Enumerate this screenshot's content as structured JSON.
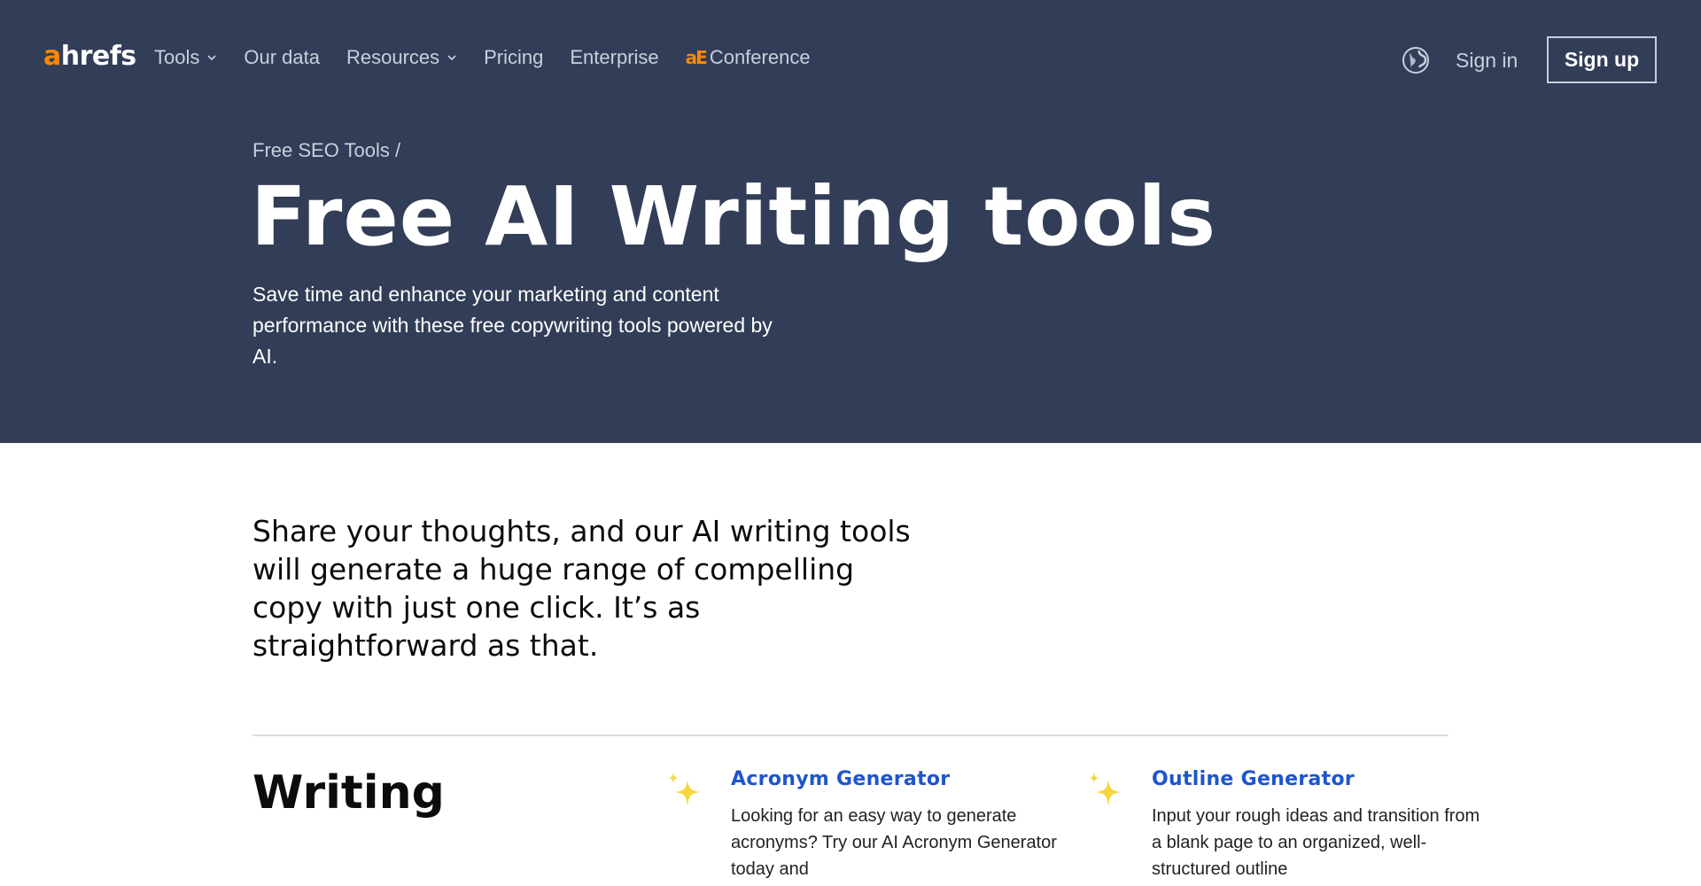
{
  "nav": {
    "logo_accent": "a",
    "logo_rest": "hrefs",
    "items": [
      {
        "label": "Tools",
        "dropdown": true
      },
      {
        "label": "Our data",
        "dropdown": false
      },
      {
        "label": "Resources",
        "dropdown": true
      },
      {
        "label": "Pricing",
        "dropdown": false
      },
      {
        "label": "Enterprise",
        "dropdown": false
      },
      {
        "label": "Conference",
        "dropdown": false
      }
    ],
    "conference_logo": "aE",
    "sign_in": "Sign in",
    "sign_up": "Sign up"
  },
  "hero": {
    "breadcrumb": "Free SEO Tools /",
    "title": "Free AI Writing tools",
    "subtitle": "Save time and enhance your marketing and content performance with these free copywriting tools powered by AI."
  },
  "intro": "Share your thoughts, and our AI writing tools will generate a huge range of compelling copy with just one click. It’s as straightforward as that.",
  "section": {
    "title": "Writing",
    "cards": [
      {
        "name": "Acronym Generator",
        "description": "Looking for an easy way to generate acronyms? Try our AI Acronym Generator today and"
      },
      {
        "name": "Outline Generator",
        "description": "Input your rough ideas and transition from a blank page to an organized, well-structured outline"
      }
    ]
  },
  "colors": {
    "header_bg": "#323d57",
    "brand_orange": "#ff8800",
    "link_blue": "#1d55cc",
    "sparkle_yellow": "#f5d63d"
  }
}
